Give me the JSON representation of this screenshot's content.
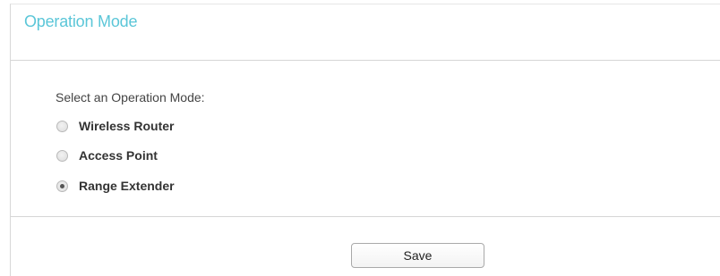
{
  "panel": {
    "title": "Operation Mode",
    "title_color": "#5bc6d8"
  },
  "operation_mode": {
    "prompt": "Select an Operation Mode:",
    "options": [
      {
        "label": "Wireless Router",
        "selected": false
      },
      {
        "label": "Access Point",
        "selected": false
      },
      {
        "label": "Range Extender",
        "selected": true
      }
    ]
  },
  "actions": {
    "save_label": "Save"
  }
}
